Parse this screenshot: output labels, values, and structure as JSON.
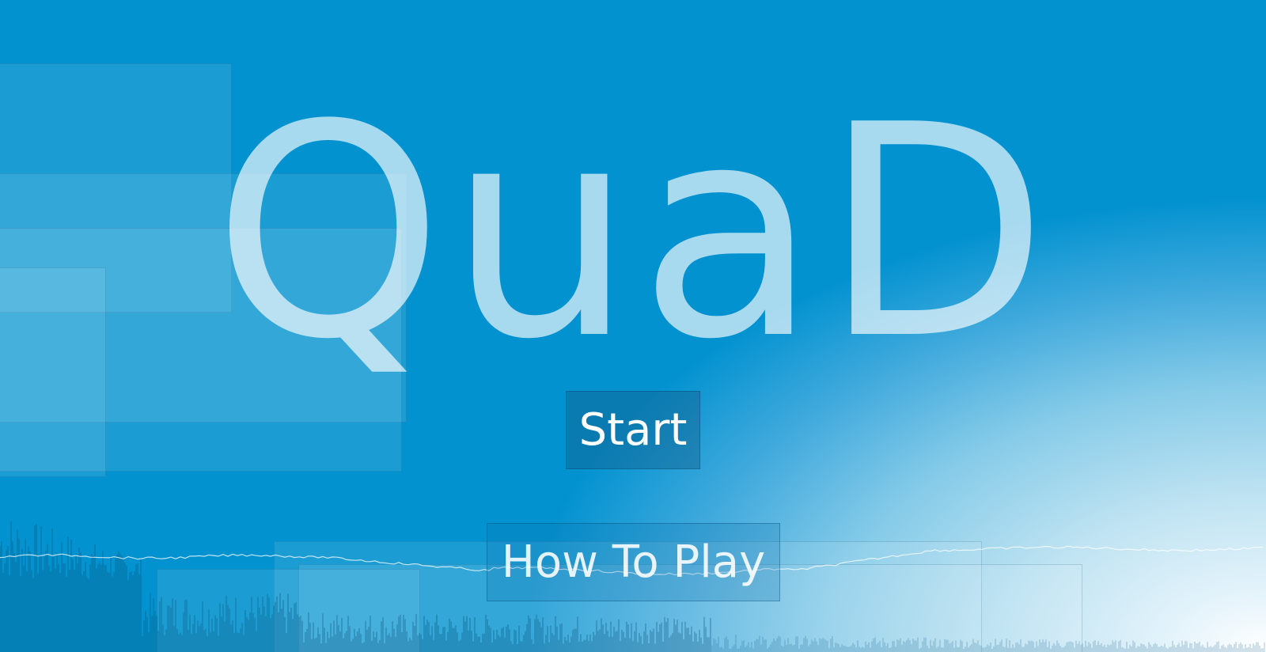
{
  "game": {
    "title": "QuaD"
  },
  "menu": {
    "start_label": "Start",
    "how_to_play_label": "How To Play"
  },
  "colors": {
    "background_top": "#0292d0",
    "background_glow": "#ffffff",
    "title_text": "#b5e1f2",
    "button_text": "#ffffff",
    "waveform_dark": "#0a4f75"
  }
}
